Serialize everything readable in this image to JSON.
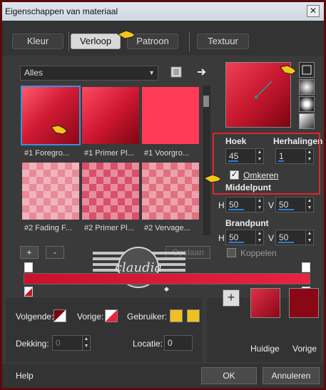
{
  "window": {
    "title": "Eigenschappen van materiaal",
    "close_glyph": "✕"
  },
  "tabs": [
    {
      "label": "Kleur"
    },
    {
      "label": "Verloop"
    },
    {
      "label": "Patroon"
    },
    {
      "label": "Textuur"
    }
  ],
  "gallery": {
    "category": "Alles",
    "tiles": [
      {
        "label": "#1 Foregro..."
      },
      {
        "label": "#1 Primer Pl..."
      },
      {
        "label": "#1 Voorgro..."
      },
      {
        "label": "#2 Fading F..."
      },
      {
        "label": "#2 Primer Pl..."
      },
      {
        "label": "#2 Vervage..."
      }
    ],
    "add_label": "+",
    "remove_label": "-",
    "save_label": "Opslaan"
  },
  "settings": {
    "angle_label": "Hoek",
    "angle_value": "45",
    "repeats_label": "Herhalingen",
    "repeats_value": "1",
    "invert_label": "Omkeren",
    "invert_checked": "✓",
    "center_label": "Middelpunt",
    "center_h_label": "H",
    "center_h_value": "50",
    "center_v_label": "V",
    "center_v_value": "50",
    "focal_label": "Brandpunt",
    "focal_h_label": "H",
    "focal_h_value": "50",
    "focal_v_label": "V",
    "focal_v_value": "50",
    "link_label": "Koppelen"
  },
  "stops": {
    "next_label": "Volgende:",
    "prev_label": "Vorige:",
    "user_label": "Gebruiker:",
    "opacity_label": "Dekking:",
    "opacity_value": "0",
    "location_label": "Locatie:",
    "location_value": "0"
  },
  "current": {
    "add_glyph": "+",
    "current_label": "Huidige",
    "previous_label": "Vorige"
  },
  "watermark": {
    "text": "claudia"
  },
  "footer": {
    "help": "Help",
    "ok": "OK",
    "cancel": "Annuleren"
  },
  "colors": {
    "accent_red": "#e0242e",
    "gradient_dark": "#7a0510",
    "gradient_light": "#ff4a62",
    "user_yellow": "#f0c020",
    "selection_blue": "#3a8fe0"
  }
}
